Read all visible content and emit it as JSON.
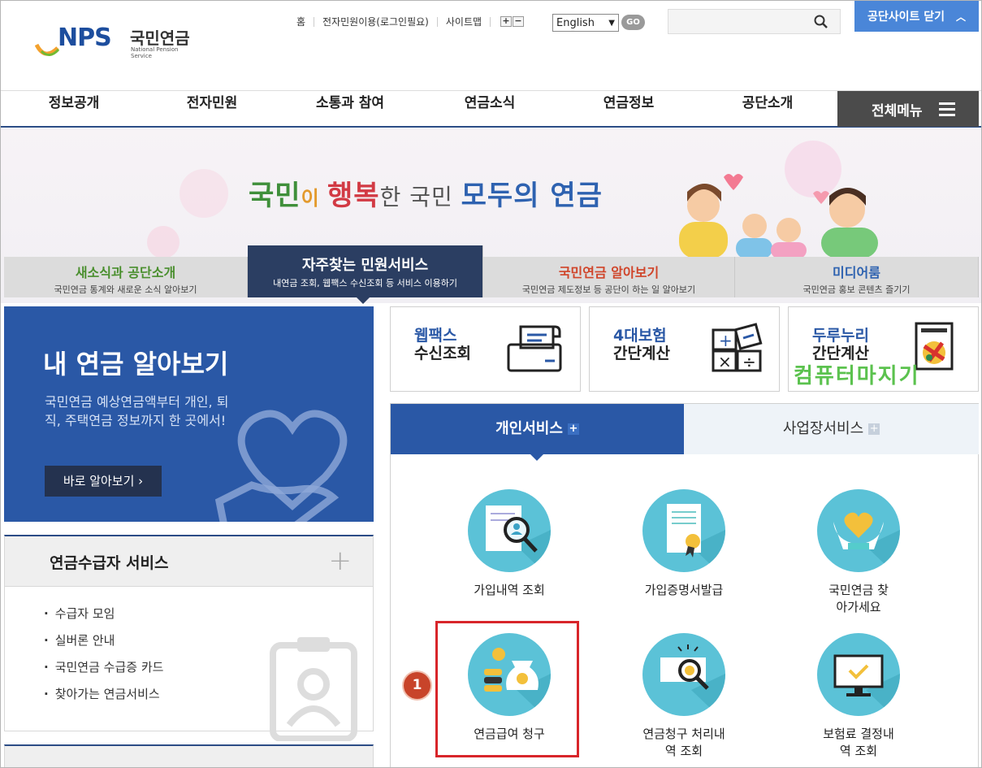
{
  "header": {
    "logo_main": "NPS",
    "logo_kr": "국민연금",
    "logo_en": "National Pension Service",
    "util_links": [
      "홈",
      "전자민원이용(로그인필요)",
      "사이트맵"
    ],
    "zoom_in": "+",
    "zoom_out": "−",
    "language": "English",
    "go_label": "GO",
    "search_placeholder": "",
    "close_site_label": "공단사이트 닫기"
  },
  "gnb": {
    "items": [
      "정보공개",
      "전자민원",
      "소통과 참여",
      "연금소식",
      "연금정보",
      "공단소개"
    ],
    "all_menu": "전체메뉴"
  },
  "banner": {
    "slogan_parts": [
      "국민",
      "이 ",
      "행복",
      "한 국민 ",
      "모두의 연금"
    ]
  },
  "main_tabs": [
    {
      "title": "새소식과 공단소개",
      "sub": "국민연금 통계와 새로운 소식 알아보기"
    },
    {
      "title": "자주찾는 민원서비스",
      "sub": "내연금 조회, 웹팩스 수신조회 등 서비스 이용하기"
    },
    {
      "title": "국민연금 알아보기",
      "sub": "국민연금 제도정보 등 공단이 하는 일 알아보기"
    },
    {
      "title": "미디어룸",
      "sub": "국민연금 홍보 콘텐츠 즐기기"
    }
  ],
  "my_pension": {
    "title": "내 연금 알아보기",
    "desc": "국민연금 예상연금액부터 개인, 퇴직, 주택연금 정보까지 한 곳에서!",
    "button": "바로 알아보기 ›"
  },
  "recipient": {
    "title": "연금수급자 서비스",
    "items": [
      "수급자 모임",
      "실버론 안내",
      "국민연금 수급증 카드",
      "찾아가는 연금서비스"
    ]
  },
  "quick": [
    {
      "line1": "웹팩스",
      "line2": "수신조회"
    },
    {
      "line1": "4대보험",
      "line2": "간단계산"
    },
    {
      "line1": "두루누리",
      "line2": "간단계산"
    }
  ],
  "overlay_text": "컴퓨터마지기",
  "service_tabs": {
    "personal": "개인서비스",
    "business": "사업장서비스"
  },
  "services": [
    {
      "label": "가입내역 조회",
      "icon": "document-search-icon"
    },
    {
      "label": "가입증명서발급",
      "icon": "certificate-icon"
    },
    {
      "label": "국민연금 찾아가세요",
      "icon": "heart-hands-icon"
    },
    {
      "label": "연금급여 청구",
      "icon": "money-bag-icon"
    },
    {
      "label": "연금청구 처리내역 조회",
      "icon": "receipt-search-icon"
    },
    {
      "label": "보험료 결정내역 조회",
      "icon": "monitor-check-icon"
    }
  ],
  "annotation_number": "1",
  "colors": {
    "brand_blue": "#2a58a6",
    "navy": "#2b3e62",
    "icon_bg": "#5bc2d7",
    "highlight_red": "#d8252a"
  }
}
